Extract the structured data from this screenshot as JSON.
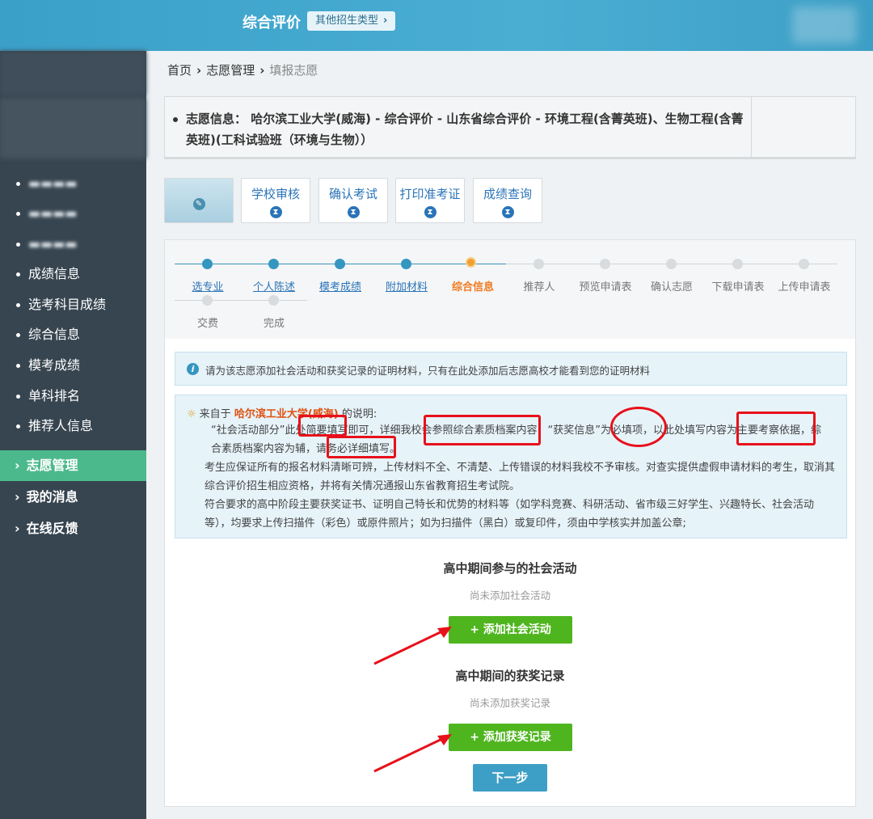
{
  "header": {
    "title": "综合评价",
    "type_button": "其他招生类型",
    "chevron_icon": "chevron-right-icon"
  },
  "sidebar": {
    "items": [
      {
        "label": "成绩信息"
      },
      {
        "label": "选考科目成绩"
      },
      {
        "label": "综合信息"
      },
      {
        "label": "模考成绩"
      },
      {
        "label": "单科排名"
      },
      {
        "label": "推荐人信息"
      }
    ],
    "menus": [
      {
        "label": "志愿管理",
        "active": true
      },
      {
        "label": "我的消息",
        "active": false
      },
      {
        "label": "在线反馈",
        "active": false
      }
    ],
    "active_color": "#4cb98c"
  },
  "breadcrumb": {
    "home": "首页",
    "section": "志愿管理",
    "current": "填报志愿"
  },
  "info": {
    "line1": "志愿信息： 哈尔滨工业大学(威海) - 综合评价 - 山东省综合评价 - 环境工程(含菁英班)、生物工程(含菁",
    "line2": "英班)(工科试验班（环境与生物））"
  },
  "tabs": [
    {
      "label": "学校审核"
    },
    {
      "label": "确认考试"
    },
    {
      "label": "打印准考证"
    },
    {
      "label": "成绩查询"
    }
  ],
  "steps": [
    {
      "label": "选专业",
      "state": "done"
    },
    {
      "label": "个人陈述",
      "state": "done"
    },
    {
      "label": "模考成绩",
      "state": "done"
    },
    {
      "label": "附加材料",
      "state": "done"
    },
    {
      "label": "综合信息",
      "state": "current"
    },
    {
      "label": "推荐人",
      "state": "todo"
    },
    {
      "label": "预览申请表",
      "state": "todo"
    },
    {
      "label": "确认志愿",
      "state": "todo"
    },
    {
      "label": "下载申请表",
      "state": "todo"
    },
    {
      "label": "上传申请表",
      "state": "todo"
    },
    {
      "label": "交费",
      "state": "todo"
    },
    {
      "label": "完成",
      "state": "todo"
    }
  ],
  "notice": {
    "text": "请为该志愿添加社会活动和获奖记录的证明材料，只有在此处添加后志愿高校才能看到您的证明材料"
  },
  "description": {
    "from_prefix": "来自于",
    "school": "哈尔滨工业大学(威海)",
    "from_suffix": "的说明:",
    "p1a": "“社会活动部分”此处简要填写即可，详细我校会参照综合素质档案内容；“获奖信息”为必填项，以此处填写内容为主要考察依据，综",
    "p1b": "合素质档案内容为辅，请务必详细填写。",
    "p2a": "考生应保证所有的报名材料清晰可辨，上传材料不全、不清楚、上传错误的材料我校不予审核。对查实提供虚假申请材料的考生，取消其",
    "p2b": "综合评价招生相应资格，并将有关情况通报山东省教育招生考试院。",
    "p3a": "符合要求的高中阶段主要获奖证书、证明自己特长和优势的材料等（如学科竞赛、科研活动、省市级三好学生、兴趣特长、社会活动",
    "p3b": "等），均要求上传扫描件（彩色）或原件照片；如为扫描件（黑白）或复印件，须由中学核实并加盖公章;"
  },
  "social": {
    "title": "高中期间参与的社会活动",
    "empty": "尚未添加社会活动",
    "button": "+ 添加社会活动"
  },
  "awards": {
    "title": "高中期间的获奖记录",
    "empty": "尚未添加获奖记录",
    "button": "+ 添加获奖记录"
  },
  "next_button": "下一步",
  "colors": {
    "primary": "#3596c0",
    "current_step": "#f07a20",
    "green_button": "#4fb51f",
    "annotation": "#e8101a"
  }
}
